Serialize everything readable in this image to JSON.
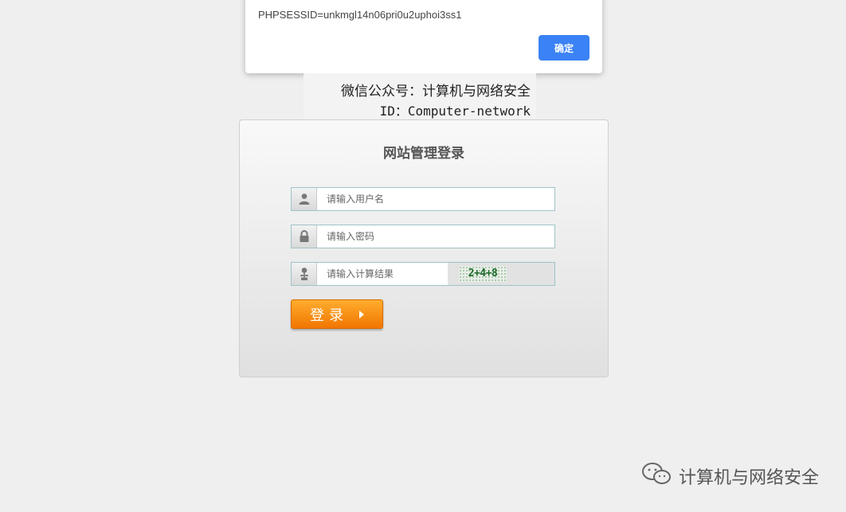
{
  "alert": {
    "message": "PHPSESSID=unkmgl14n06pri0u2uphoi3ss1",
    "ok_label": "确定"
  },
  "watermark": {
    "line1": "微信公众号：计算机与网络安全",
    "line2": "ID：Computer-network"
  },
  "login": {
    "title": "网站管理登录",
    "username_placeholder": "请输入用户名",
    "password_placeholder": "请输入密码",
    "captcha_placeholder": "请输入计算结果",
    "captcha_text": "2+4+8",
    "submit_label": "登录"
  },
  "brand": {
    "text": "计算机与网络安全",
    "icon": "wechat-icon"
  },
  "colors": {
    "alert_button": "#3b82f6",
    "login_button": "#f17600",
    "field_border": "#9fc3c8"
  }
}
